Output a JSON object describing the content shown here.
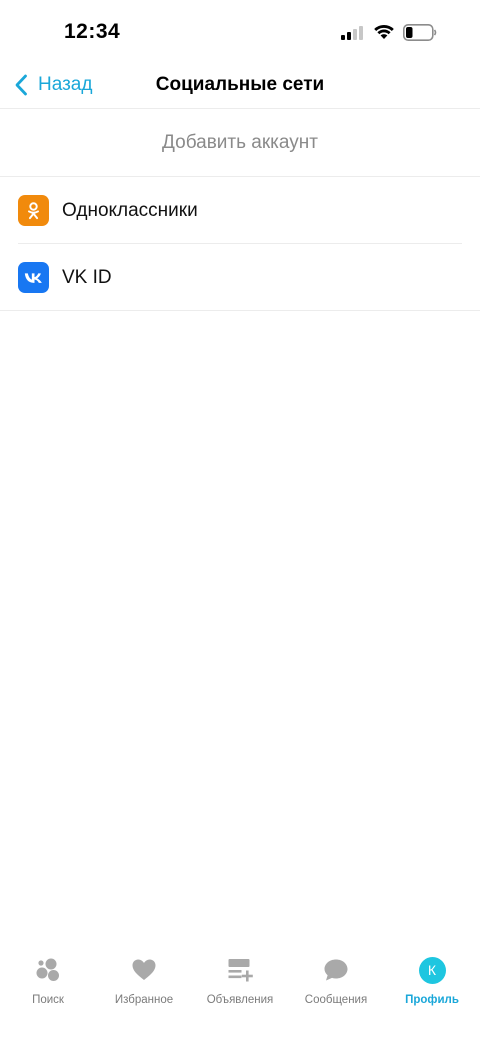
{
  "status_bar": {
    "time": "12:34"
  },
  "nav": {
    "back_label": "Назад",
    "title": "Социальные сети"
  },
  "add_account": {
    "label": "Добавить аккаунт"
  },
  "social_accounts": [
    {
      "label": "Одноклассники",
      "icon": "odnoklassniki-icon",
      "color": "#f18a0c"
    },
    {
      "label": "VK ID",
      "icon": "vk-icon",
      "color": "#1877f2"
    }
  ],
  "tabs": [
    {
      "label": "Поиск",
      "icon": "search-bubbles-icon",
      "active": false
    },
    {
      "label": "Избранное",
      "icon": "heart-icon",
      "active": false
    },
    {
      "label": "Объявления",
      "icon": "add-list-icon",
      "active": false
    },
    {
      "label": "Сообщения",
      "icon": "chat-bubble-icon",
      "active": false
    },
    {
      "label": "Профиль",
      "icon": "profile-avatar-icon",
      "active": true
    }
  ],
  "profile_avatar": {
    "initial": "К"
  },
  "colors": {
    "accent": "#1aa7d9",
    "ok_orange": "#f18a0c",
    "vk_blue": "#1877f2",
    "avatar": "#1ec6e0",
    "inactive_icon": "#a9a9a9"
  }
}
